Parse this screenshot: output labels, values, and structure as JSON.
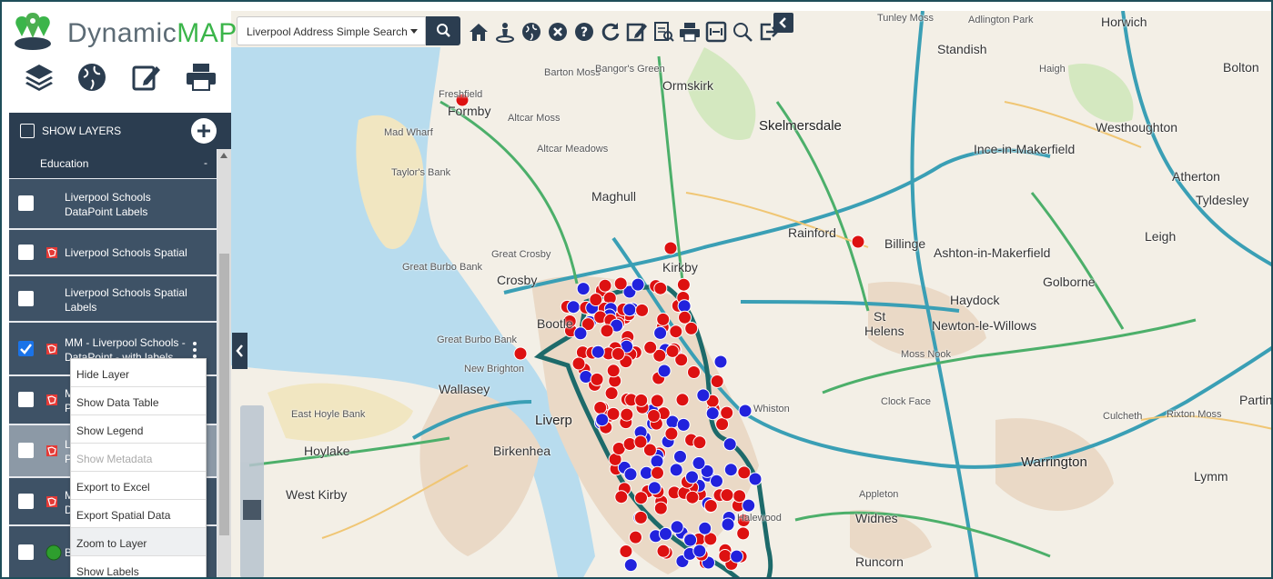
{
  "app": {
    "logo_part1": "Dynamic",
    "logo_part2": "MAPS",
    "brand_green": "#3bb54a",
    "brand_dark": "#2b3d50"
  },
  "search": {
    "selected": "Liverpool Address Simple Search",
    "icon": "search-icon"
  },
  "toolbar": {
    "icons": [
      "home-icon",
      "locate-icon",
      "globe-icon",
      "clear-icon",
      "help-icon",
      "refresh-icon",
      "edit-icon",
      "report-icon",
      "print-icon",
      "fit-icon",
      "magnify-icon",
      "export-icon"
    ]
  },
  "left_tools": {
    "icons": [
      "layers-icon",
      "globe-icon",
      "edit-icon",
      "print-icon"
    ]
  },
  "layers": {
    "show_label": "SHOW LAYERS",
    "group": "Education",
    "collapse_symbol": "-",
    "rows": [
      {
        "line1": "Liverpool Schools",
        "line2": "DataPoint Labels",
        "checked": false,
        "icon": ""
      },
      {
        "line1": "Liverpool Schools Spatial",
        "line2": "",
        "checked": false,
        "icon": "spatial-layer-icon"
      },
      {
        "line1": "Liverpool Schools Spatial",
        "line2": "Labels",
        "checked": false,
        "icon": ""
      },
      {
        "line1": "MM - Liverpool Schools -",
        "line2": "DataPoint - with labels",
        "checked": true,
        "icon": "spatial-layer-icon"
      },
      {
        "line1": "M",
        "line2": "P",
        "checked": false,
        "icon": "spatial-layer-icon"
      },
      {
        "line1": "L",
        "line2": "P",
        "checked": false,
        "icon": "spatial-layer-icon"
      },
      {
        "line1": "M",
        "line2": "D",
        "checked": false,
        "icon": "spatial-layer-icon"
      },
      {
        "line1": "B",
        "line2": "",
        "checked": false,
        "icon": "green-dot-icon"
      }
    ]
  },
  "context_menu": [
    {
      "label": "Hide Layer",
      "enabled": true
    },
    {
      "label": "Show Data Table",
      "enabled": true
    },
    {
      "label": "Show Legend",
      "enabled": true
    },
    {
      "label": "Show Metadata",
      "enabled": false
    },
    {
      "label": "Export to Excel",
      "enabled": true
    },
    {
      "label": "Export Spatial Data",
      "enabled": true
    },
    {
      "label": "Zoom to Layer",
      "enabled": true
    },
    {
      "label": "Show Labels",
      "enabled": true
    }
  ],
  "map": {
    "places": {
      "formby": "Formby",
      "ormskirk": "Ormskirk",
      "skelmersdale": "Skelmersdale",
      "maghull": "Maghull",
      "rainford": "Rainford",
      "billinge": "Billinge",
      "kirkby": "Kirkby",
      "crosby": "Crosby",
      "bootle": "Bootle",
      "wallasey": "Wallasey",
      "liverpool": "Liverp",
      "birkenhead": "Birkenhea",
      "hoylake": "Hoylake",
      "west_kirby": "West Kirby",
      "st_helens_1": "St",
      "st_helens_2": "Helens",
      "haydock": "Haydock",
      "newton": "Newton-le-Willows",
      "golborne": "Golborne",
      "ashton": "Ashton-in-Makerfield",
      "ince": "Ince-in-Makerfield",
      "westhoughton": "Westhoughton",
      "standish": "Standish",
      "horwich": "Horwich",
      "bolton": "Bolton",
      "atherton": "Atherton",
      "tyldesley": "Tyldesley",
      "leigh": "Leigh",
      "warrington": "Warrington",
      "widnes": "Widnes",
      "runcorn": "Runcorn",
      "lymm": "Lymm",
      "partington": "Parting",
      "tunley_moss": "Tunley Moss",
      "adlington": "Adlington Park",
      "barton_moss": "Barton Moss",
      "bangors_green": "Bangor's Green",
      "freshfield": "Freshfield",
      "altcar_moss": "Altcar Moss",
      "mad_wharf": "Mad Wharf",
      "taylors_bank": "Taylor's Bank",
      "altcar_meadows": "Altcar Meadows",
      "great_crosby": "Great Crosby",
      "great_burbo": "Great Burbo Bank",
      "great_burbo2": "Great Burbo Bank",
      "new_brighton": "New Brighton",
      "east_hoyle": "East Hoyle Bank",
      "mossway": "Moss",
      "halewood": "Halewood",
      "appleton": "Appleton",
      "rixton": "Rixton Moss",
      "culcheth": "Culcheth",
      "haigh": "Haigh",
      "high_coppull": "Skelmersdale",
      "billinge_label": "Billinge",
      "moss_nook": "Moss Nook",
      "clock_face": "Clock Face",
      "whiston": "Whiston"
    }
  }
}
